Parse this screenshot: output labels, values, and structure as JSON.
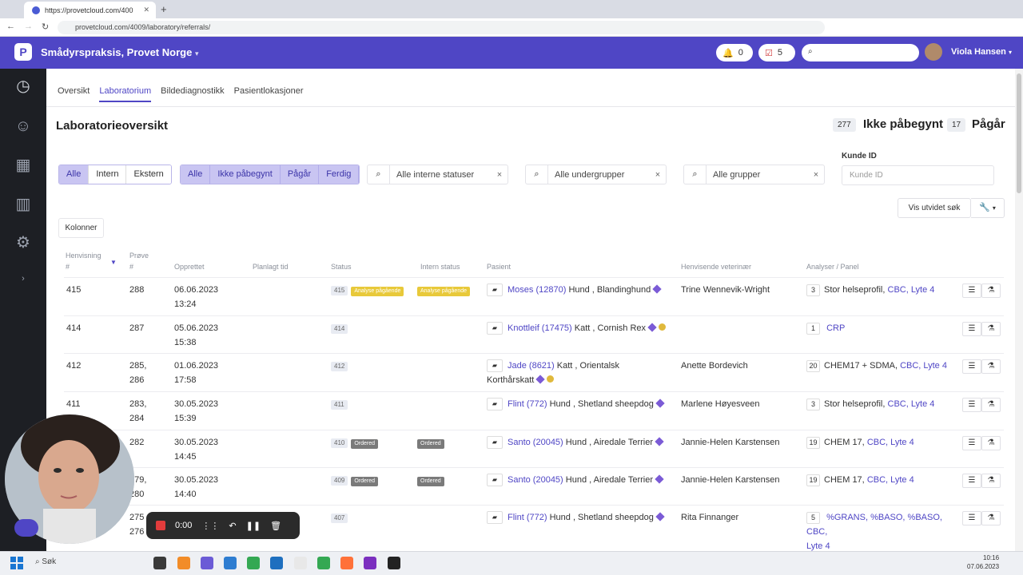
{
  "browser": {
    "tab_title": "https://provetcloud.com/400",
    "url": "provetcloud.com/4009/laboratory/referrals/"
  },
  "header": {
    "clinic": "Smådyrspraksis, Provet Norge",
    "notifications": "0",
    "tasks": "5",
    "user": "Viola Hansen"
  },
  "subnav": {
    "tabs": [
      "Oversikt",
      "Laboratorium",
      "Bildediagnostikk",
      "Pasientlokasjoner"
    ]
  },
  "page": {
    "title": "Laboratorieoversikt",
    "count_not_started": "277",
    "label_not_started": "Ikke påbegynt",
    "count_in_progress": "17",
    "label_in_progress": "Pågår"
  },
  "filters": {
    "type_segments": [
      "Alle",
      "Intern",
      "Ekstern"
    ],
    "status_segments": [
      "Alle",
      "Ikke påbegynt",
      "Pågår",
      "Ferdig"
    ],
    "internal_status": "Alle interne statuser",
    "subgroups": "Alle undergrupper",
    "groups": "Alle grupper",
    "kunde_label": "Kunde ID",
    "kunde_placeholder": "Kunde ID",
    "extended_search": "Vis utvidet søk",
    "columns_button": "Kolonner"
  },
  "table": {
    "headers": {
      "henvisning": "Henvisning",
      "henvisning_hash": "#",
      "prove": "Prøve",
      "prove_hash": "#",
      "opprettet": "Opprettet",
      "planlagt": "Planlagt tid",
      "status": "Status",
      "intern": "Intern status",
      "pasient": "Pasient",
      "veterinaer": "Henvisende veterinær",
      "analyser": "Analyser / Panel"
    },
    "rows": [
      {
        "ref": "415",
        "sample": "288",
        "sample2": "",
        "date": "06.06.2023",
        "time": "13:24",
        "status_num": "415",
        "status_tag": "Analyse pågående",
        "intern_tag": "Analyse pågående",
        "patient_link": "Moses (12870)",
        "patient_rest": "Hund , Blandinghund",
        "patient_rest2": "",
        "vet": "Trine Wennevik-Wright",
        "count": "3",
        "analysis": "Stor helseprofil,",
        "analysis_links": "CBC, Lyte 4",
        "analysis2": ""
      },
      {
        "ref": "414",
        "sample": "287",
        "sample2": "",
        "date": "05.06.2023",
        "time": "15:38",
        "status_num": "414",
        "status_tag": "",
        "intern_tag": "",
        "patient_link": "Knottleif (17475)",
        "patient_rest": "Katt , Cornish Rex",
        "patient_rest2": "",
        "vet": "",
        "count": "1",
        "analysis": "",
        "analysis_links": "CRP",
        "analysis2": ""
      },
      {
        "ref": "412",
        "sample": "285,",
        "sample2": "286",
        "date": "01.06.2023",
        "time": "17:58",
        "status_num": "412",
        "status_tag": "",
        "intern_tag": "",
        "patient_link": "Jade (8621)",
        "patient_rest": "Katt , Orientalsk",
        "patient_rest2": "Korthårskatt",
        "vet": "Anette Bordevich",
        "count": "20",
        "analysis": "CHEM17 + SDMA,",
        "analysis_links": "CBC, Lyte 4",
        "analysis2": ""
      },
      {
        "ref": "411",
        "sample": "283,",
        "sample2": "284",
        "date": "30.05.2023",
        "time": "15:39",
        "status_num": "411",
        "status_tag": "",
        "intern_tag": "",
        "patient_link": "Flint (772)",
        "patient_rest": "Hund , Shetland sheepdog",
        "patient_rest2": "",
        "vet": "Marlene Høyesveen",
        "count": "3",
        "analysis": "Stor helseprofil,",
        "analysis_links": "CBC, Lyte 4",
        "analysis2": ""
      },
      {
        "ref": "",
        "sample": "282",
        "sample2": "",
        "date": "30.05.2023",
        "time": "14:45",
        "status_num": "410",
        "status_tag": "Ordered",
        "intern_tag": "Ordered",
        "patient_link": "Santo (20045)",
        "patient_rest": "Hund , Airedale Terrier",
        "patient_rest2": "",
        "vet": "Jannie-Helen Karstensen",
        "count": "19",
        "analysis": "CHEM 17,",
        "analysis_links": "CBC, Lyte 4",
        "analysis2": ""
      },
      {
        "ref": "",
        "sample": "279,",
        "sample2": "280",
        "date": "30.05.2023",
        "time": "14:40",
        "status_num": "409",
        "status_tag": "Ordered",
        "intern_tag": "Ordered",
        "patient_link": "Santo (20045)",
        "patient_rest": "Hund , Airedale Terrier",
        "patient_rest2": "",
        "vet": "Jannie-Helen Karstensen",
        "count": "19",
        "analysis": "CHEM 17,",
        "analysis_links": "CBC, Lyte 4",
        "analysis2": ""
      },
      {
        "ref": "",
        "sample": "275",
        "sample2": "276",
        "date": "",
        "time": "",
        "status_num": "407",
        "status_tag": "",
        "intern_tag": "",
        "patient_link": "Flint (772)",
        "patient_rest": "Hund , Shetland sheepdog",
        "patient_rest2": "",
        "vet": "Rita Finnanger",
        "count": "5",
        "analysis": "",
        "analysis_links": "%GRANS, %BASO, %BASO, CBC,",
        "analysis2": "Lyte 4"
      }
    ]
  },
  "recorder": {
    "time": "0:00"
  },
  "taskbar": {
    "search": "Søk",
    "time": "10:16",
    "date": "07.06.2023"
  },
  "colors": {
    "brand": "#4f46c5",
    "sidebar": "#1d1f24",
    "status_yellow": "#e8c93a",
    "status_grey": "#7a7a7a"
  }
}
